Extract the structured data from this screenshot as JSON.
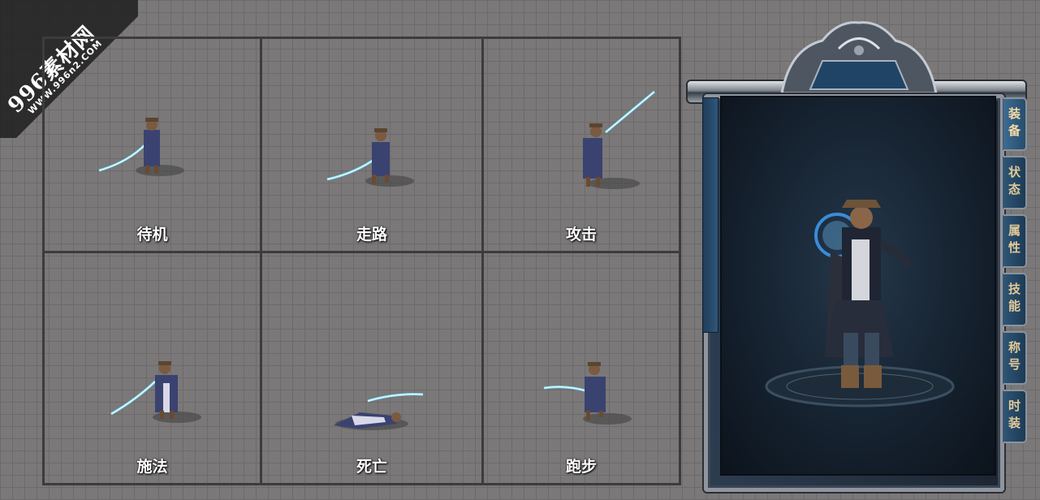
{
  "watermark": {
    "line1": "996素材网",
    "line2": "WWW.996n2.COM"
  },
  "animations": [
    {
      "label": "待机"
    },
    {
      "label": "走路"
    },
    {
      "label": "攻击"
    },
    {
      "label": "施法"
    },
    {
      "label": "死亡"
    },
    {
      "label": "跑步"
    }
  ],
  "side_tabs": [
    {
      "label": "装备"
    },
    {
      "label": "状态"
    },
    {
      "label": "属性"
    },
    {
      "label": "技能"
    },
    {
      "label": "称号"
    },
    {
      "label": "时装"
    }
  ],
  "colors": {
    "background": "#7a7878",
    "grid_line": "#3c3c3c",
    "tab_text": "#e2c998",
    "tab_bg": "#2e5676",
    "sword_glow": "#7fe0ff"
  }
}
